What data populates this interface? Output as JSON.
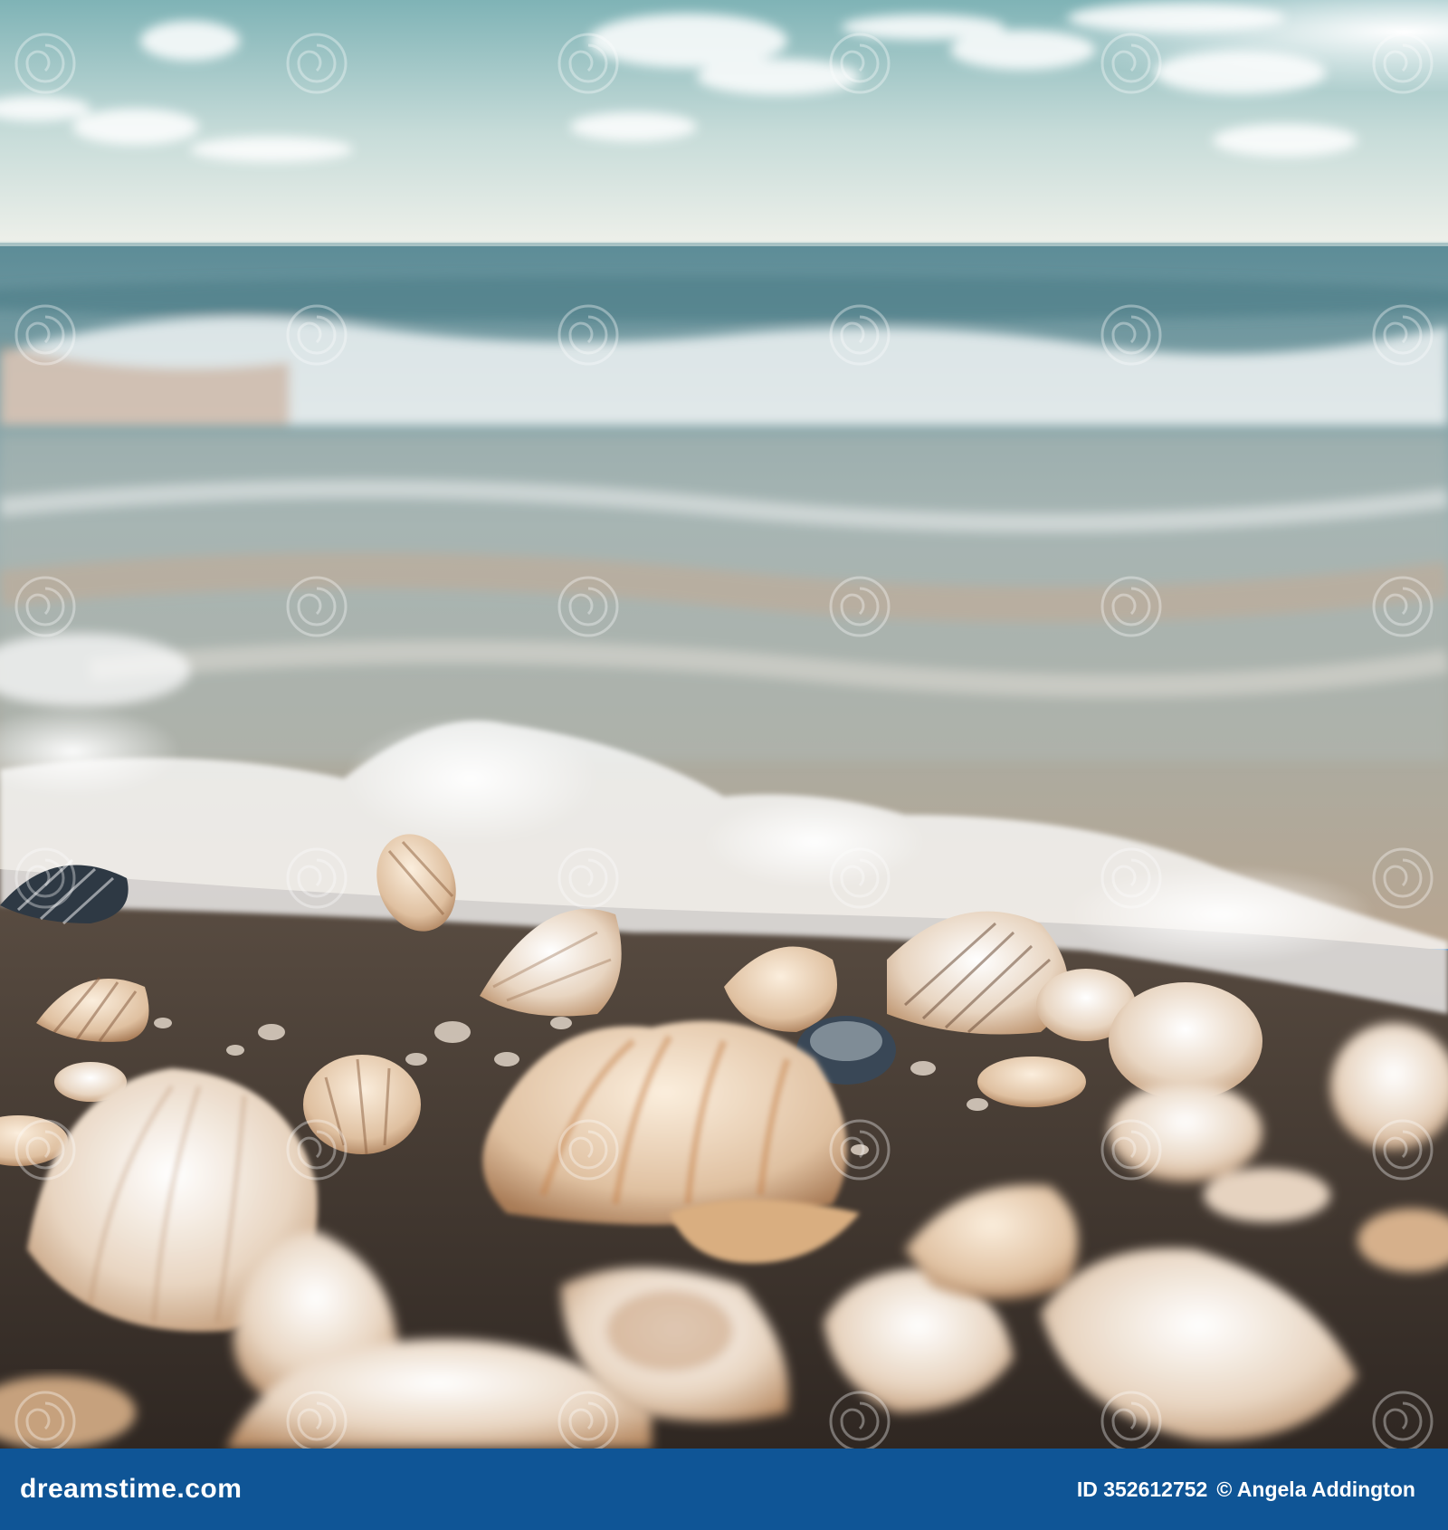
{
  "footer": {
    "brand": "dreamstime.com",
    "id_text": "ID 352612752",
    "author_text": "© Angela Addington",
    "bar_color": "#0f5596"
  },
  "watermark": {
    "text": "dreamstime",
    "icon": "spiral-logo-icon"
  }
}
